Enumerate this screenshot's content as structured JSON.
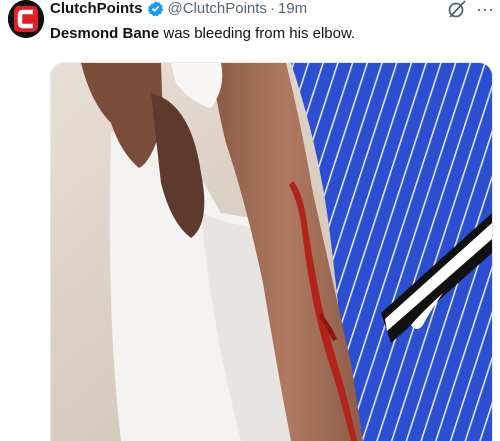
{
  "author": {
    "display_name": "ClutchPoints",
    "handle": "@ClutchPoints",
    "separator": "·",
    "time": "19m",
    "avatar_letter": "C",
    "brand_color": "#e21f26",
    "verified_icon": "verified-badge-icon"
  },
  "tweet": {
    "mention": "Desmond Bane",
    "text_rest": " was bleeding from his elbow."
  },
  "media": {
    "kind": "photo",
    "uniform_color": "#2b4fd0",
    "stripe_color": "#ffffff",
    "blood_color": "#b2231a"
  },
  "actions": {
    "grok_icon": "grok-icon",
    "more_icon": "more-horizontal-icon",
    "more_glyph": "···"
  }
}
